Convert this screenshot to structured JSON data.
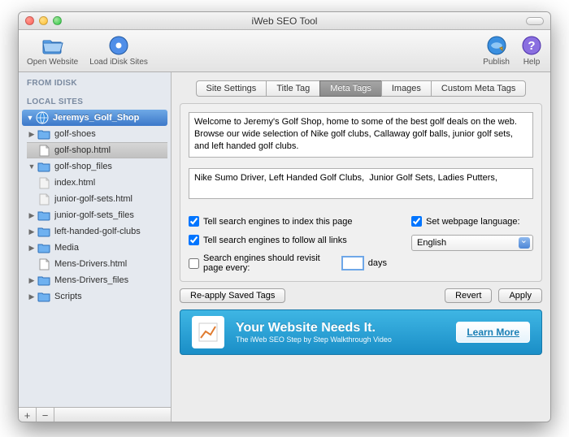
{
  "window": {
    "title": "iWeb SEO Tool"
  },
  "toolbar": {
    "open_website": "Open Website",
    "load_idisk": "Load iDisk Sites",
    "publish": "Publish",
    "help": "Help"
  },
  "sidebar": {
    "from_idisk": "FROM IDISK",
    "local_sites": "LOCAL SITES",
    "site_name": "Jeremys_Golf_Shop",
    "items": [
      {
        "label": "golf-shoes",
        "type": "folder",
        "indent": 1
      },
      {
        "label": "golf-shop.html",
        "type": "file",
        "indent": 1,
        "selected": true
      },
      {
        "label": "golf-shop_files",
        "type": "folder",
        "indent": 1,
        "expanded": true
      },
      {
        "label": "index.html",
        "type": "file",
        "indent": 2
      },
      {
        "label": "junior-golf-sets.html",
        "type": "file",
        "indent": 2
      },
      {
        "label": "junior-golf-sets_files",
        "type": "folder",
        "indent": 1
      },
      {
        "label": "left-handed-golf-clubs",
        "type": "folder",
        "indent": 1
      },
      {
        "label": "Media",
        "type": "folder",
        "indent": 1
      },
      {
        "label": "Mens-Drivers.html",
        "type": "file",
        "indent": 1
      },
      {
        "label": "Mens-Drivers_files",
        "type": "folder",
        "indent": 1
      },
      {
        "label": "Scripts",
        "type": "folder",
        "indent": 1
      }
    ]
  },
  "tabs": {
    "site_settings": "Site Settings",
    "title_tag": "Title Tag",
    "meta_tags": "Meta Tags",
    "images": "Images",
    "custom": "Custom Meta Tags"
  },
  "meta": {
    "description": "Welcome to Jeremy's Golf Shop, home to some of the best golf deals on the web. Browse our wide selection of Nike golf clubs, Callaway golf balls, junior golf sets, and left handed golf clubs.",
    "keywords": "Nike Sumo Driver, Left Handed Golf Clubs,  Junior Golf Sets, Ladies Putters,",
    "chk_index": "Tell search engines to index this page",
    "chk_follow": "Tell search engines to follow all links",
    "chk_revisit": "Search engines should revisit page every:",
    "days": "days",
    "chk_lang": "Set webpage language:",
    "lang_value": "English",
    "revisit_value": ""
  },
  "buttons": {
    "reapply": "Re-apply Saved Tags",
    "revert": "Revert",
    "apply": "Apply"
  },
  "banner": {
    "title": "Your Website Needs It.",
    "subtitle": "The iWeb SEO Step by Step Walkthrough Video",
    "cta": "Learn More"
  }
}
